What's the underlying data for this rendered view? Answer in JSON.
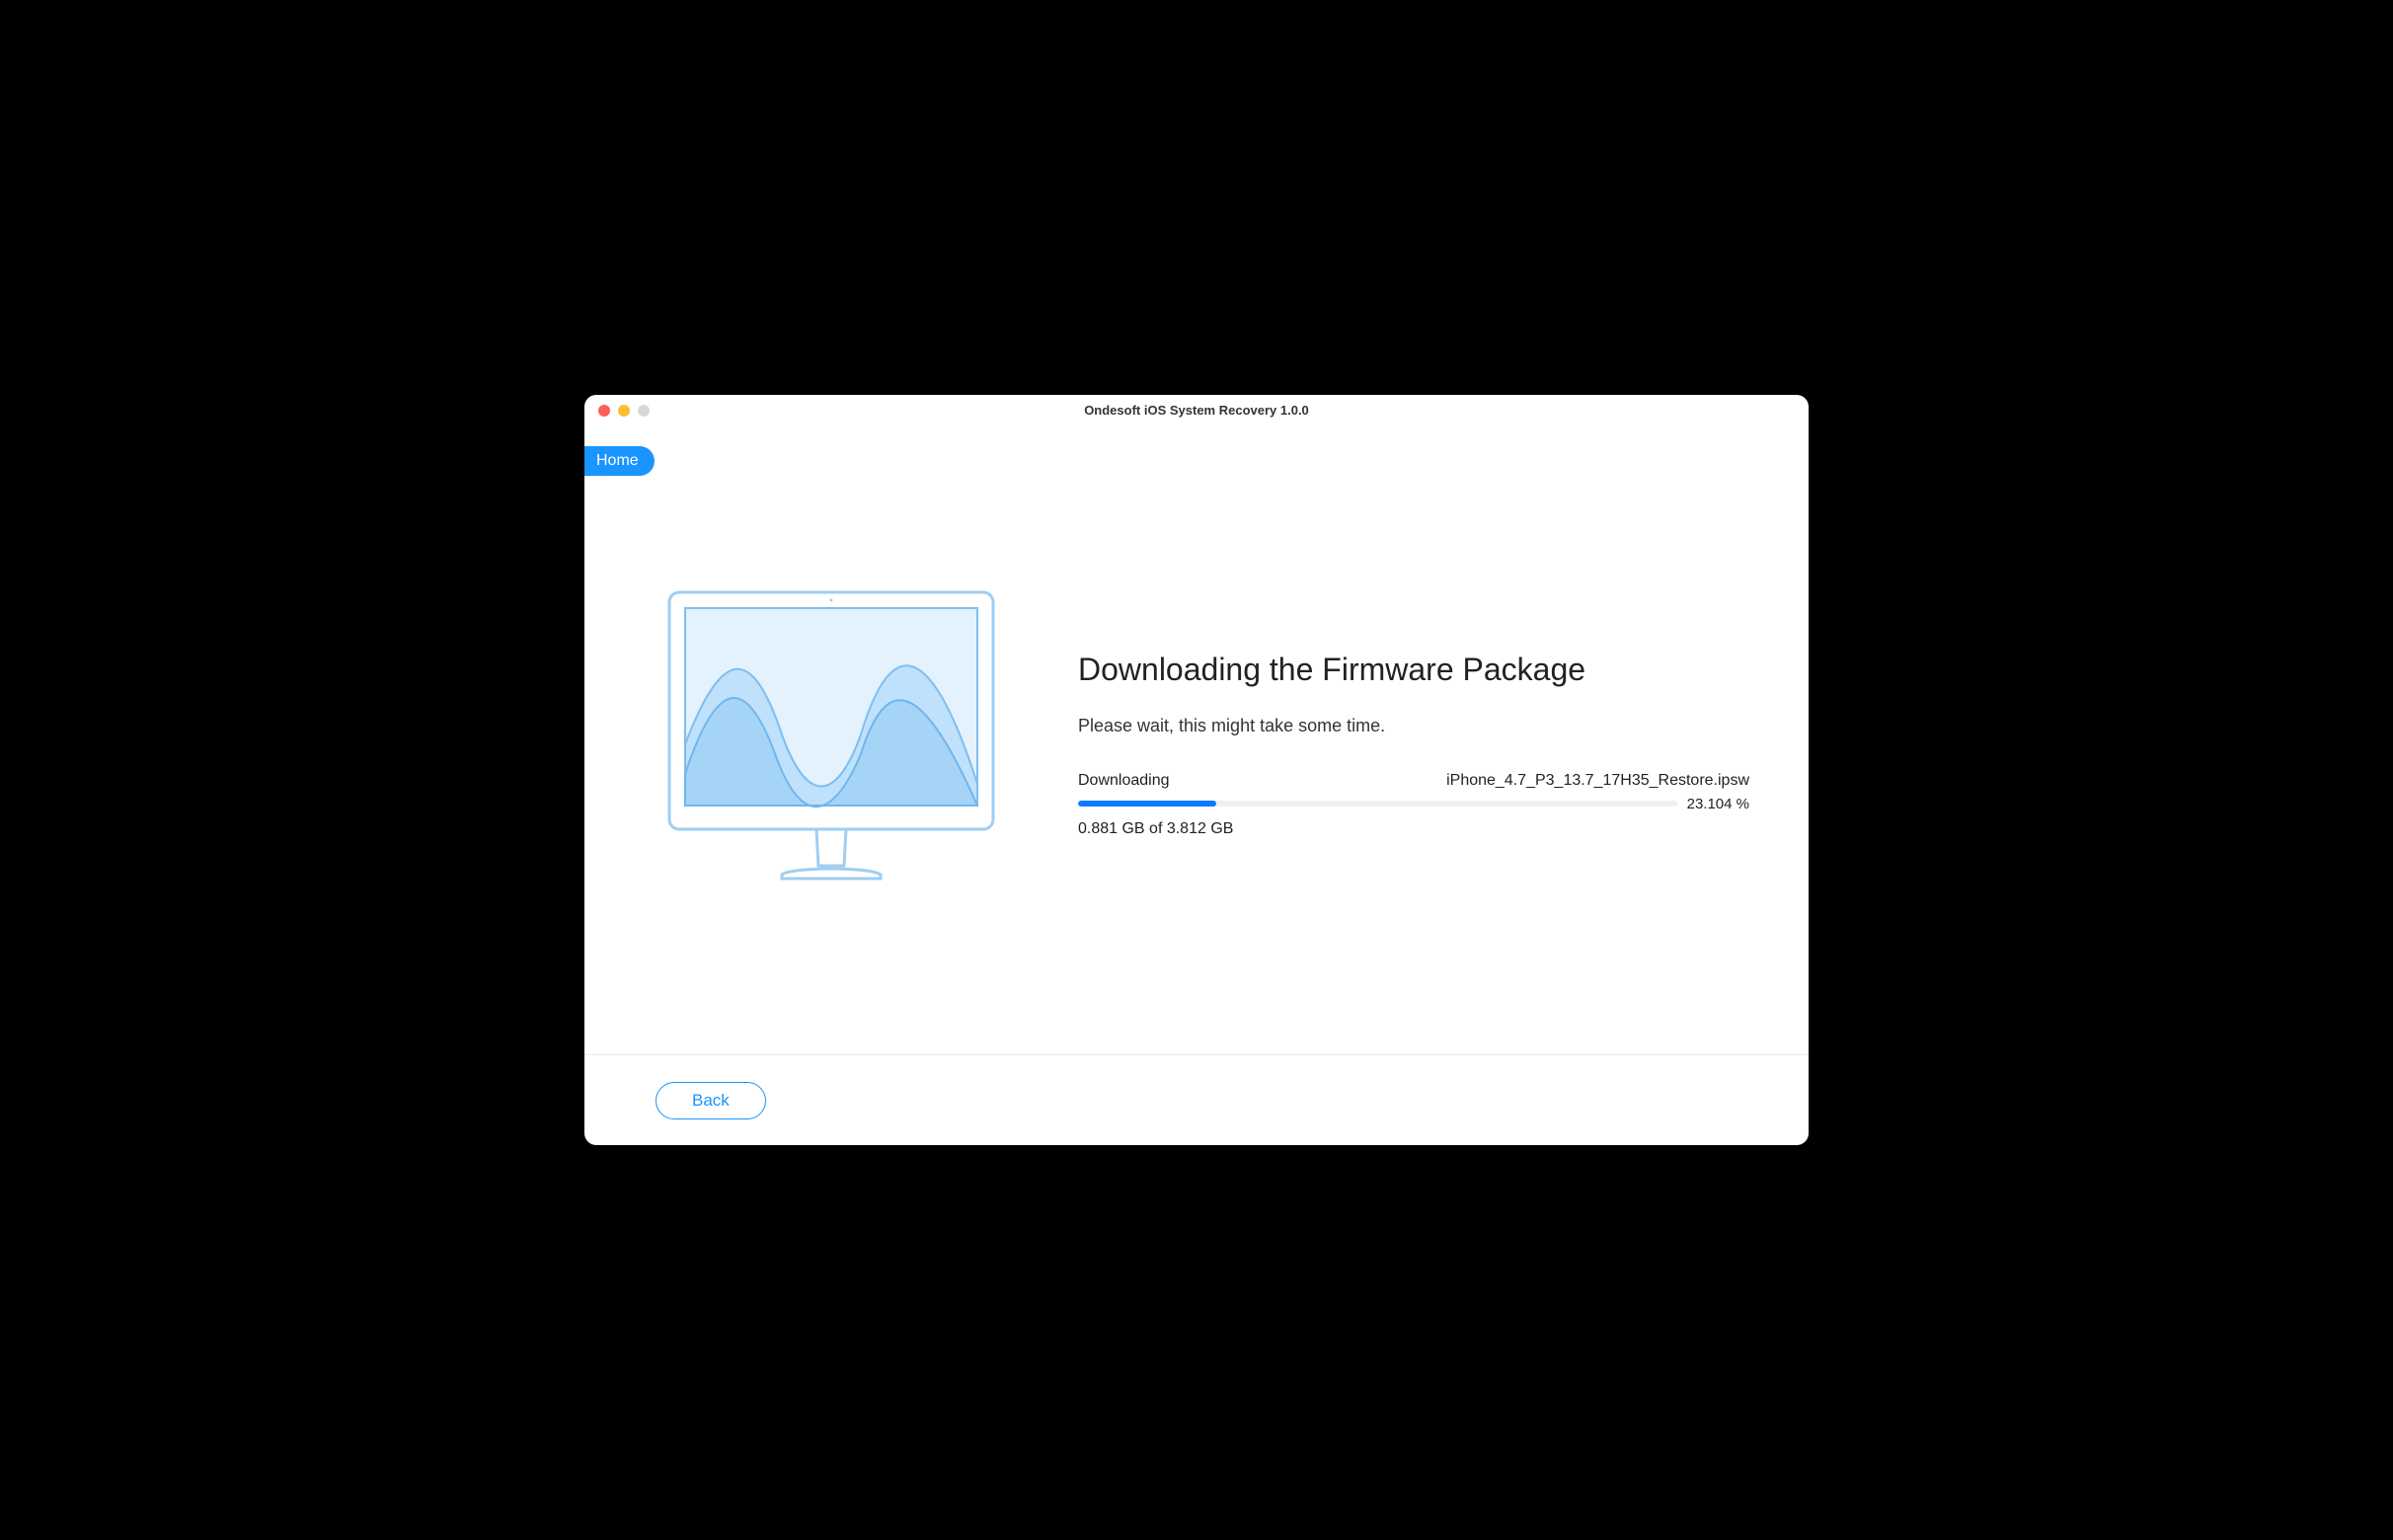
{
  "window": {
    "title": "Ondesoft iOS System Recovery 1.0.0"
  },
  "nav": {
    "home_label": "Home"
  },
  "main": {
    "heading": "Downloading the Firmware Package",
    "subtext": "Please wait, this might take some time.",
    "status_label": "Downloading",
    "filename": "iPhone_4.7_P3_13.7_17H35_Restore.ipsw",
    "progress_percent": "23.104 %",
    "progress_value": 23.104,
    "size_text": "0.881 GB of 3.812 GB"
  },
  "footer": {
    "back_label": "Back"
  }
}
